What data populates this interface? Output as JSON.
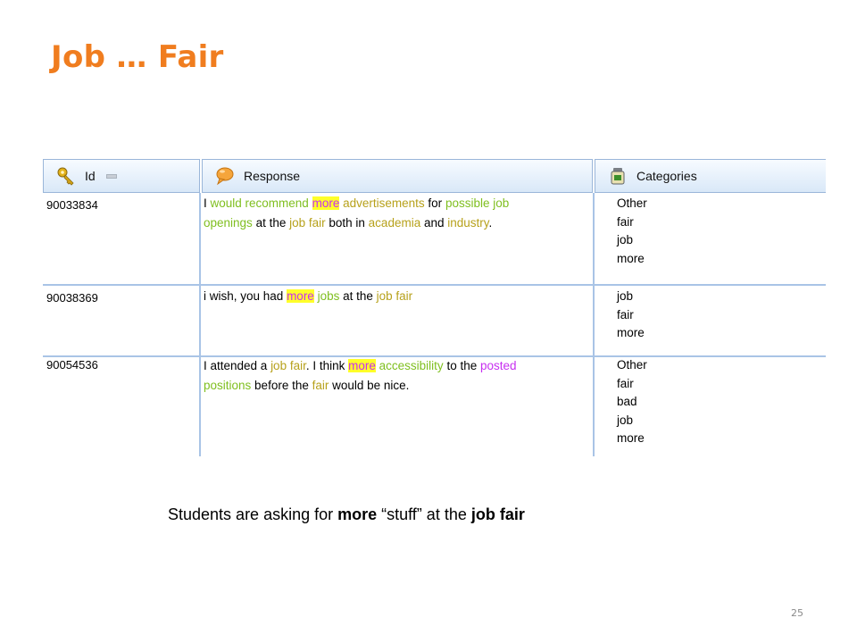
{
  "slide": {
    "title": "Job … Fair",
    "page_number": "25"
  },
  "grid": {
    "columns": [
      {
        "label": "Id",
        "icon": "key-icon"
      },
      {
        "label": "Response",
        "icon": "speech-bubble-icon"
      },
      {
        "label": "Categories",
        "icon": "jar-icon"
      }
    ],
    "rows": [
      {
        "id": "90033834",
        "response_line1": [
          {
            "t": "I ",
            "c": "w"
          },
          {
            "t": "would recommend",
            "c": "g"
          },
          {
            "t": " ",
            "c": "w"
          },
          {
            "t": "more",
            "c": "hl"
          },
          {
            "t": " ",
            "c": "w"
          },
          {
            "t": "advertisements",
            "c": "o"
          },
          {
            "t": " for ",
            "c": "w"
          },
          {
            "t": "possible job",
            "c": "g"
          }
        ],
        "response_line2": [
          {
            "t": "openings",
            "c": "g"
          },
          {
            "t": " at the ",
            "c": "w"
          },
          {
            "t": "job fair",
            "c": "o"
          },
          {
            "t": " both in ",
            "c": "w"
          },
          {
            "t": "academia",
            "c": "o"
          },
          {
            "t": " and ",
            "c": "w"
          },
          {
            "t": "industry",
            "c": "o"
          },
          {
            "t": ".",
            "c": "w"
          }
        ],
        "categories": [
          "Other",
          "fair",
          "job",
          "more"
        ]
      },
      {
        "id": "90038369",
        "response_line1": [
          {
            "t": "i wish, you had ",
            "c": "w"
          },
          {
            "t": "more",
            "c": "hl"
          },
          {
            "t": " ",
            "c": "w"
          },
          {
            "t": "jobs",
            "c": "g"
          },
          {
            "t": " at the ",
            "c": "w"
          },
          {
            "t": "job fair",
            "c": "o"
          }
        ],
        "response_line2": [],
        "categories": [
          "job",
          "fair",
          "more"
        ]
      },
      {
        "id": "90054536",
        "response_line1": [
          {
            "t": "I attended a ",
            "c": "w"
          },
          {
            "t": "job fair",
            "c": "o"
          },
          {
            "t": ". I think ",
            "c": "w"
          },
          {
            "t": "more",
            "c": "hl"
          },
          {
            "t": " ",
            "c": "w"
          },
          {
            "t": "accessibility",
            "c": "g"
          },
          {
            "t": " to the ",
            "c": "w"
          },
          {
            "t": "posted",
            "c": "p"
          }
        ],
        "response_line2": [
          {
            "t": "positions",
            "c": "g"
          },
          {
            "t": " before the ",
            "c": "w"
          },
          {
            "t": "fair",
            "c": "o"
          },
          {
            "t": " would be nice.",
            "c": "w"
          }
        ],
        "categories": [
          "Other",
          "fair",
          "bad",
          "job",
          "more"
        ]
      }
    ]
  },
  "caption": {
    "prefix": "Students are asking for ",
    "bold1": "more",
    "middle": " “stuff” at the ",
    "bold2": "job fair"
  },
  "colors": {
    "title": "#f07d1f",
    "green_term": "#7fbf1f",
    "olive_term": "#b7a11b",
    "purple_term": "#c72ff0",
    "highlight": "#ffff2a"
  }
}
